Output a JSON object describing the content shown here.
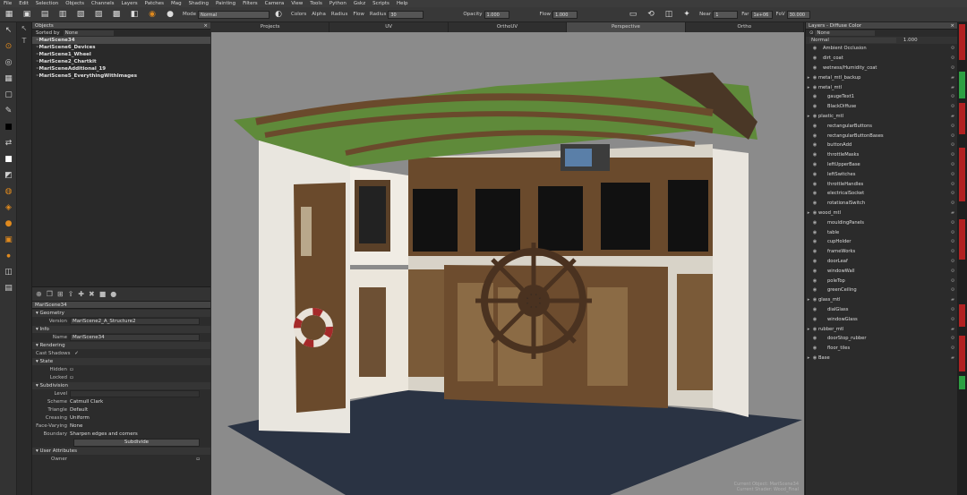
{
  "menu": [
    "File",
    "Edit",
    "Selection",
    "Objects",
    "Channels",
    "Layers",
    "Patches",
    "Mag",
    "Shading",
    "Painting",
    "Filters",
    "Camera",
    "View",
    "Tools",
    "Python",
    "Gskz",
    "Scripts",
    "Help"
  ],
  "toolbar": {
    "mode_label": "Mode",
    "mode_value": "Normal",
    "colors_label": "Colors",
    "alpha_label": "Alpha",
    "radius_label": "Radius",
    "flow_label": "Flow",
    "radius_value_label": "Radius",
    "radius_value": "30",
    "opacity_label": "Opacity",
    "opacity_value": "1.000",
    "flow_value_label": "Flow",
    "flow_value": "1.000",
    "near_label": "Near",
    "near_value": "1",
    "far_label": "Far",
    "far_value": "1e+06",
    "fov_label": "FoV",
    "fov_value": "30.000"
  },
  "objects_panel": {
    "title": "Objects",
    "sorted_label": "Sorted by",
    "sorted_value": "None",
    "items": [
      "MariScene34",
      "MariScene6_Devices",
      "MariScene1_Wheel",
      "MariScene2_Chartkit",
      "MariSceneAdditional_19",
      "MariScene5_EverythingWithImages"
    ]
  },
  "props": {
    "title": "MariScene34",
    "geometry": "Geometry",
    "version_label": "Version",
    "version_value": "MariScene2_A_Structure2",
    "info": "Info",
    "name_label": "Name",
    "name_value": "MariScene34",
    "rendering": "Rendering",
    "cast_shadows": "Cast Shadows",
    "state": "State",
    "hidden": "Hidden",
    "locked": "Locked",
    "subdivision": "Subdivision",
    "level_label": "Level",
    "scheme_label": "Scheme",
    "scheme_value": "Catmull Clark",
    "triangle_label": "Triangle",
    "triangle_value": "Default",
    "creasing_label": "Creasing",
    "creasing_value": "Uniform",
    "facevarying_label": "Face-Varying",
    "facevarying_value": "None",
    "boundary_label": "Boundary",
    "boundary_value": "Sharpen edges and corners",
    "subdivide_btn": "Subdivide",
    "user_attr": "User Attributes",
    "owner_label": "Owner"
  },
  "view_tabs": [
    "Projects",
    "UV",
    "OrthoUV",
    "Perspective",
    "Ortho"
  ],
  "active_tab": "Perspective",
  "watermark": [
    "Current Object: MariScene34",
    "Current Shader: Wood_Final"
  ],
  "layers_panel": {
    "title": "Layers - Diffuse Color",
    "filter_value": "None",
    "blend_value": "Normal",
    "opacity_value": "1.000",
    "items": [
      {
        "name": "Ambient Occlusion",
        "indent": 1
      },
      {
        "name": "dirt_coat",
        "indent": 1
      },
      {
        "name": "wetness/Humidity_coat",
        "indent": 1
      },
      {
        "name": "metal_mtl_backup",
        "indent": 0
      },
      {
        "name": "metal_mtl",
        "indent": 0
      },
      {
        "name": "gaugeText1",
        "indent": 2
      },
      {
        "name": "BlackDiffuse",
        "indent": 2
      },
      {
        "name": "plastic_mtl",
        "indent": 0
      },
      {
        "name": "rectangularButtons",
        "indent": 2
      },
      {
        "name": "rectangularButtonBases",
        "indent": 2
      },
      {
        "name": "buttonAdd",
        "indent": 2
      },
      {
        "name": "throttleMasks",
        "indent": 2
      },
      {
        "name": "leftUpperBase",
        "indent": 2
      },
      {
        "name": "leftSwitches",
        "indent": 2
      },
      {
        "name": "throttleHandles",
        "indent": 2
      },
      {
        "name": "electricalSocket",
        "indent": 2
      },
      {
        "name": "rotationalSwitch",
        "indent": 2
      },
      {
        "name": "wood_mtl",
        "indent": 0
      },
      {
        "name": "mouldingPanels",
        "indent": 2
      },
      {
        "name": "table",
        "indent": 2
      },
      {
        "name": "cupHolder",
        "indent": 2
      },
      {
        "name": "frameWorks",
        "indent": 2
      },
      {
        "name": "doorLeaf",
        "indent": 2
      },
      {
        "name": "windowWall",
        "indent": 2
      },
      {
        "name": "poleTop",
        "indent": 2
      },
      {
        "name": "greenCeiling",
        "indent": 2
      },
      {
        "name": "glass_mtl",
        "indent": 0
      },
      {
        "name": "dialGlass",
        "indent": 2
      },
      {
        "name": "windowGlass",
        "indent": 2
      },
      {
        "name": "rubber_mtl",
        "indent": 0
      },
      {
        "name": "doorStop_rubber",
        "indent": 2
      },
      {
        "name": "floor_tiles",
        "indent": 2
      },
      {
        "name": "Base",
        "indent": 0
      }
    ]
  },
  "colors": {
    "accent": "#e08a1e",
    "meter_green": "#2ea043",
    "meter_red": "#b22222"
  }
}
